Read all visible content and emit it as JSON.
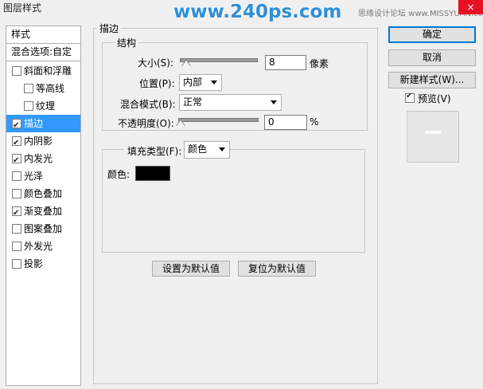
{
  "window": {
    "title": "图层样式"
  },
  "watermark": {
    "text": "www.240ps.com"
  },
  "site_mark": {
    "text": "思缘设计论坛 www.MISSYUAN.com"
  },
  "close_icon": "×",
  "left": {
    "header": "样式",
    "blend_options": "混合选项:自定",
    "items": [
      {
        "label": "斜面和浮雕",
        "checked": false
      },
      {
        "label": "等高线",
        "checked": false
      },
      {
        "label": "纹理",
        "checked": false
      },
      {
        "label": "描边",
        "checked": true,
        "selected": true
      },
      {
        "label": "内阴影",
        "checked": true
      },
      {
        "label": "内发光",
        "checked": true
      },
      {
        "label": "光泽",
        "checked": false
      },
      {
        "label": "颜色叠加",
        "checked": false
      },
      {
        "label": "渐变叠加",
        "checked": true
      },
      {
        "label": "图案叠加",
        "checked": false
      },
      {
        "label": "外发光",
        "checked": false
      },
      {
        "label": "投影",
        "checked": false
      }
    ]
  },
  "stroke": {
    "group_title": "描边",
    "structure_title": "结构",
    "size_label": "大小(S):",
    "size_value": "8",
    "size_unit": "像素",
    "position_label": "位置(P):",
    "position_value": "内部",
    "blend_label": "混合模式(B):",
    "blend_value": "正常",
    "opacity_label": "不透明度(O):",
    "opacity_value": "0",
    "opacity_unit": "%",
    "fill_type_label": "填充类型(F):",
    "fill_type_value": "颜色",
    "color_label": "颜色:",
    "color": "#000000",
    "set_default": "设置为默认值",
    "reset_default": "复位为默认值"
  },
  "right": {
    "ok": "确定",
    "cancel": "取消",
    "new_style": "新建样式(W)...",
    "preview_label": "预览(V)",
    "preview_checked": true
  }
}
